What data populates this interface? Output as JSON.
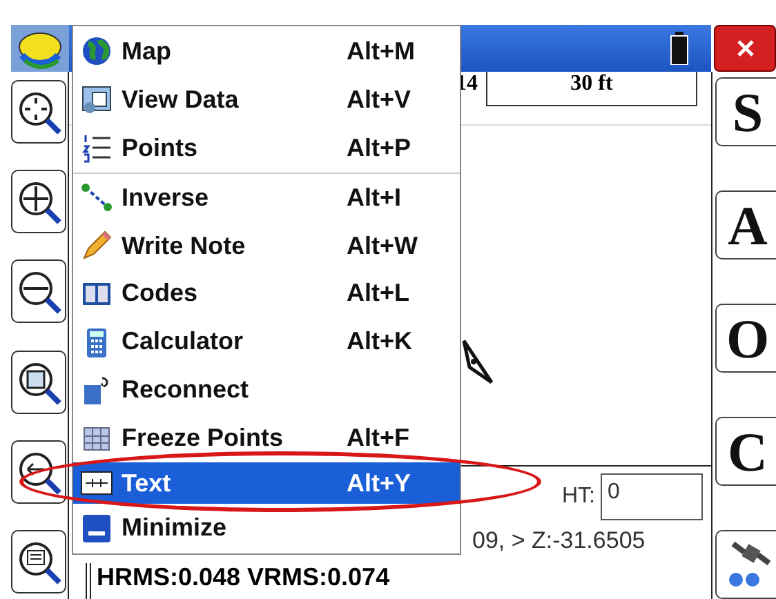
{
  "menu": {
    "items": [
      {
        "label": "Map",
        "shortcut": "Alt+M",
        "selected": false,
        "separator": false
      },
      {
        "label": "View Data",
        "shortcut": "Alt+V",
        "selected": false,
        "separator": false
      },
      {
        "label": "Points",
        "shortcut": "Alt+P",
        "selected": false,
        "separator": true
      },
      {
        "label": "Inverse",
        "shortcut": "Alt+I",
        "selected": false,
        "separator": false
      },
      {
        "label": "Write Note",
        "shortcut": "Alt+W",
        "selected": false,
        "separator": false
      },
      {
        "label": "Codes",
        "shortcut": "Alt+L",
        "selected": false,
        "separator": false
      },
      {
        "label": "Calculator",
        "shortcut": "Alt+K",
        "selected": false,
        "separator": false
      },
      {
        "label": "Reconnect",
        "selected": false,
        "separator": false
      },
      {
        "label": "Freeze Points",
        "shortcut": "Alt+F",
        "selected": false,
        "separator": false
      },
      {
        "label": "Text",
        "shortcut": "Alt+Y",
        "selected": true,
        "separator": false
      },
      {
        "label": "Minimize",
        "selected": false,
        "separator": false
      }
    ]
  },
  "scale_bar": {
    "left_text": "14",
    "label": "30 ft"
  },
  "right_buttons": [
    {
      "label": "S"
    },
    {
      "label": "A"
    },
    {
      "label": "O"
    },
    {
      "label": "C"
    }
  ],
  "status": {
    "ht_label": "HT:",
    "ht_value": "0",
    "coordinates": "09, > Z:-31.6505",
    "rms": "HRMS:0.048 VRMS:0.074"
  }
}
